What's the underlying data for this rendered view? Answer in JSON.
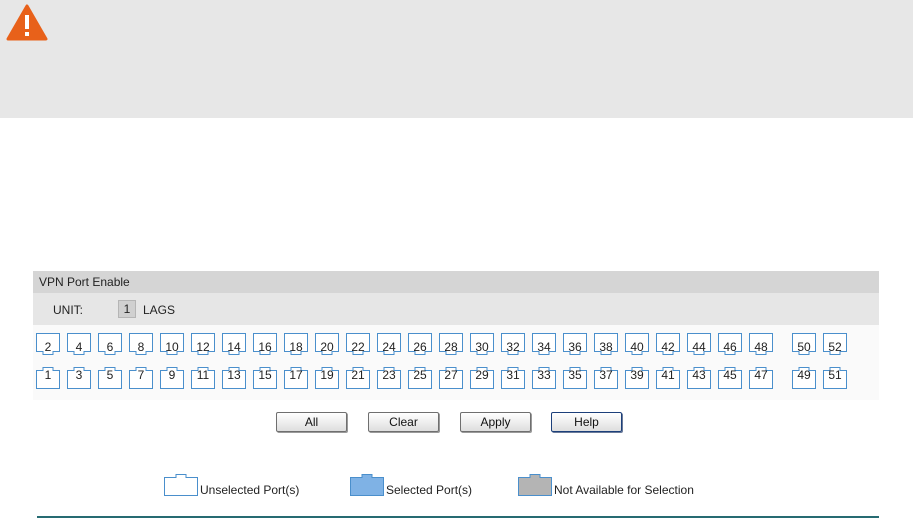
{
  "panel": {
    "title": "VPN Port Enable",
    "unit_label": "UNIT:",
    "unit_value": "1",
    "lags_label": "LAGS"
  },
  "ports": {
    "top_row": [
      "2",
      "4",
      "6",
      "8",
      "10",
      "12",
      "14",
      "16",
      "18",
      "20",
      "22",
      "24",
      "26",
      "28",
      "30",
      "32",
      "34",
      "36",
      "38",
      "40",
      "42",
      "44",
      "46",
      "48",
      "50",
      "52"
    ],
    "bottom_row": [
      "1",
      "3",
      "5",
      "7",
      "9",
      "11",
      "13",
      "15",
      "17",
      "19",
      "21",
      "23",
      "25",
      "27",
      "29",
      "31",
      "33",
      "35",
      "37",
      "39",
      "41",
      "43",
      "45",
      "47",
      "49",
      "51"
    ]
  },
  "buttons": {
    "all": "All",
    "clear": "Clear",
    "apply": "Apply",
    "help": "Help"
  },
  "legend": {
    "unselected": "Unselected Port(s)",
    "selected": "Selected Port(s)",
    "unavailable": "Not Available for Selection"
  },
  "colors": {
    "alert_background": "#e7e7e7",
    "warning_icon": "#e8611a",
    "port_outline": "#4a8fcc",
    "selected_fill": "#7fb2e5",
    "unavailable_fill": "#b4b4b4",
    "footer_rule": "#266b72"
  }
}
